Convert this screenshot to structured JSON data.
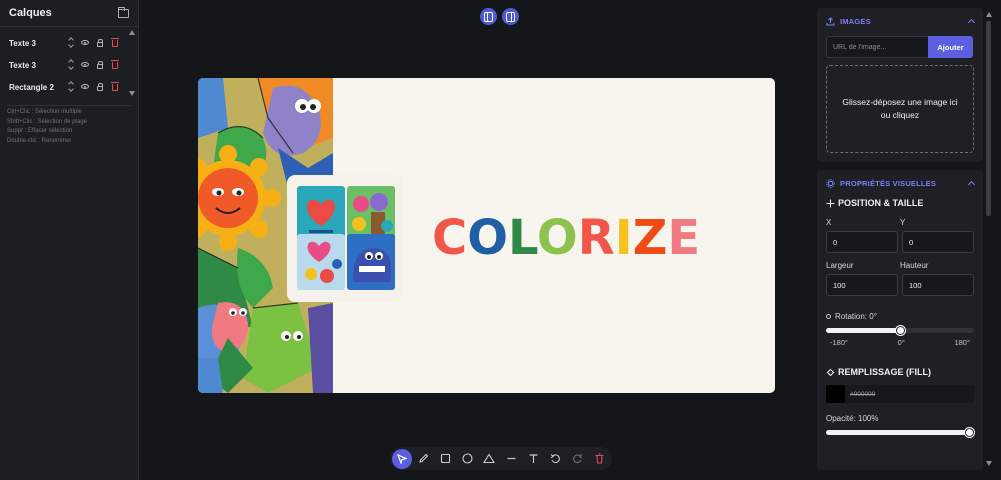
{
  "layers_panel": {
    "title": "Calques",
    "layers": [
      {
        "name": "Texte 3"
      },
      {
        "name": "Texte 3"
      },
      {
        "name": "Rectangle 2"
      }
    ],
    "help": [
      "Ctrl+Clic : Sélection multiple",
      "Shift+Clic : Sélection de plage",
      "Suppr : Effacer sélection",
      "Double-clic : Renommer"
    ]
  },
  "canvas": {
    "brand_letters": [
      {
        "char": "C",
        "color": "#f2564a"
      },
      {
        "char": "O",
        "color": "#1f5fa6"
      },
      {
        "char": "L",
        "color": "#2f8a46"
      },
      {
        "char": "O",
        "color": "#8ec24f"
      },
      {
        "char": "R",
        "color": "#f2564a"
      },
      {
        "char": "I",
        "color": "#f6c21e"
      },
      {
        "char": "Z",
        "color": "#f04b14"
      },
      {
        "char": "E",
        "color": "#f07a82"
      }
    ]
  },
  "right_panel": {
    "images": {
      "title": "IMAGES",
      "url_placeholder": "URL de l'image...",
      "add_label": "Ajouter",
      "drop_text": "Glissez-déposez une image ici ou cliquez"
    },
    "visual": {
      "title": "PROPRIÉTÉS VISUELLES",
      "position_title": "POSITION & TAILLE",
      "x_label": "X",
      "y_label": "Y",
      "x_value": "0",
      "y_value": "0",
      "width_label": "Largeur",
      "height_label": "Hauteur",
      "width_value": "100",
      "height_value": "100",
      "rotation_label": "Rotation: 0°",
      "rotation_min": "-180°",
      "rotation_mid": "0°",
      "rotation_max": "180°",
      "rotation_fraction": 0.5,
      "fill_title": "REMPLISSAGE (FILL)",
      "fill_color": "#000000",
      "opacity_label": "Opacité: 100%",
      "opacity_fraction": 1.0
    }
  },
  "colors": {
    "accent": "#5b5fe0",
    "danger": "#e5484d",
    "canvas_bg": "#f7f5ee"
  }
}
